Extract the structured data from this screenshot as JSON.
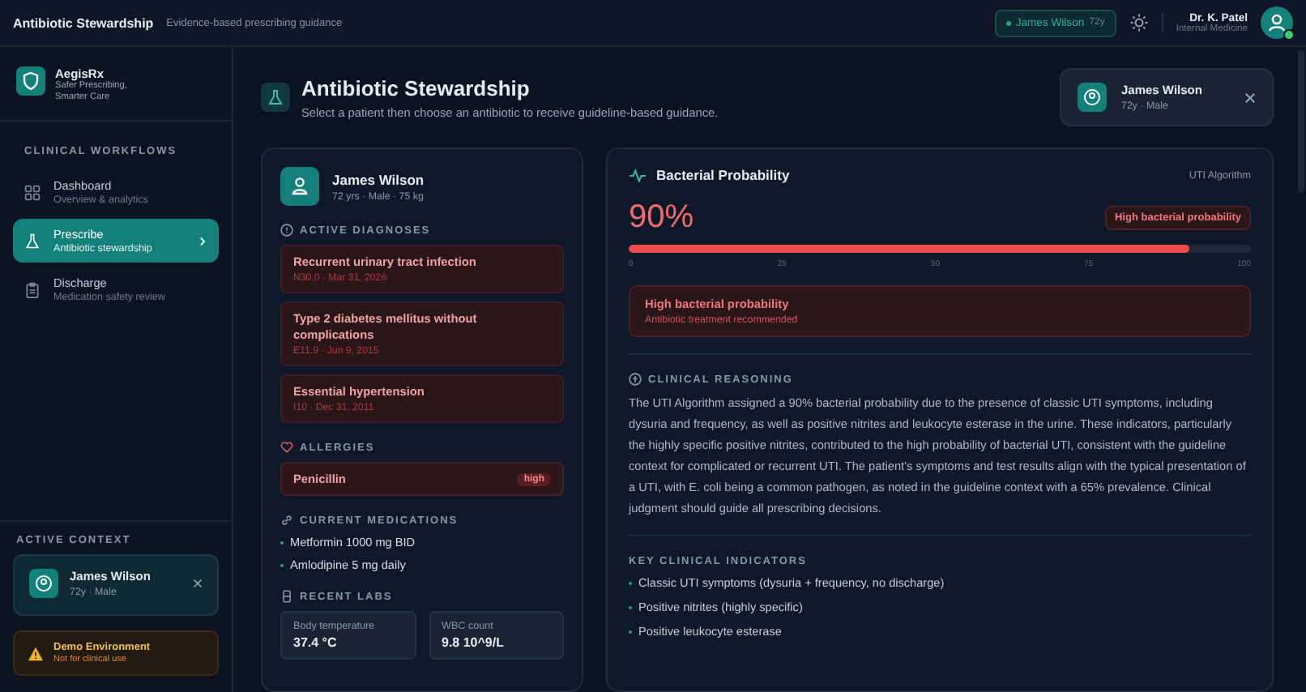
{
  "topbar": {
    "title": "Antibiotic Stewardship",
    "subtitle": "Evidence-based prescribing guidance",
    "patient_chip": {
      "name": "James Wilson",
      "age": "72y"
    },
    "user": {
      "name": "Dr. K. Patel",
      "role": "Internal Medicine",
      "online": true
    }
  },
  "sidebar": {
    "brand": {
      "name": "AegisRx",
      "tagline": "Safer Prescribing, Smarter Care"
    },
    "section_title": "CLINICAL WORKFLOWS",
    "items": [
      {
        "label": "Dashboard",
        "sublabel": "Overview & analytics",
        "selected": false
      },
      {
        "label": "Prescribe",
        "sublabel": "Antibiotic stewardship",
        "selected": true
      },
      {
        "label": "Discharge",
        "sublabel": "Medication safety review",
        "selected": false
      }
    ],
    "context_title": "ACTIVE CONTEXT",
    "context_patient": {
      "name": "James Wilson",
      "details": "72y · Male"
    },
    "warning": {
      "title": "Demo Environment",
      "subtitle": "Not for clinical use"
    }
  },
  "header": {
    "title": "Antibiotic Stewardship",
    "subtitle": "Select a patient then choose an antibiotic to receive guideline-based guidance.",
    "patient": {
      "name": "James Wilson",
      "details": "72y · Male"
    }
  },
  "patient_card": {
    "name": "James Wilson",
    "details": "72 yrs · Male · 75 kg",
    "diagnoses_title": "ACTIVE DIAGNOSES",
    "diagnoses": [
      {
        "name": "Recurrent urinary tract infection",
        "meta": "N30.0 · Mar 31, 2026"
      },
      {
        "name": "Type 2 diabetes mellitus without complications",
        "meta": "E11.9 · Jun 9, 2015"
      },
      {
        "name": "Essential hypertension",
        "meta": "I10 · Dec 31, 2011"
      }
    ],
    "allergies_title": "ALLERGIES",
    "allergies": [
      {
        "name": "Penicillin",
        "severity": "high"
      }
    ],
    "medications_title": "CURRENT MEDICATIONS",
    "medications": [
      "Metformin 1000 mg BID",
      "Amlodipine 5 mg daily"
    ],
    "labs_title": "RECENT LABS",
    "labs": [
      {
        "name": "Body temperature",
        "value": "37.4 °C"
      },
      {
        "name": "WBC count",
        "value": "9.8 10^9/L"
      }
    ]
  },
  "probability_card": {
    "title": "Bacterial Probability",
    "algorithm": "UTI Algorithm",
    "value": "90%",
    "badge": "High bacterial probability",
    "level": 0.9,
    "ticks": [
      "0",
      "25",
      "50",
      "75",
      "100"
    ],
    "alert": {
      "title": "High bacterial probability",
      "subtitle": "Antibiotic treatment recommended"
    },
    "reasoning_title": "CLINICAL REASONING",
    "reasoning": "The UTI Algorithm assigned a 90% bacterial probability due to the presence of classic UTI symptoms, including dysuria and frequency, as well as positive nitrites and leukocyte esterase in the urine. These indicators, particularly the highly specific positive nitrites, contributed to the high probability of bacterial UTI, consistent with the guideline context for complicated or recurrent UTI. The patient's symptoms and test results align with the typical presentation of a UTI, with E. coli being a common pathogen, as noted in the guideline context with a 65% prevalence. Clinical judgment should guide all prescribing decisions.",
    "indicators_title": "KEY CLINICAL INDICATORS",
    "indicators": [
      "Classic UTI symptoms (dysuria + frequency, no discharge)",
      "Positive nitrites (highly specific)",
      "Positive leukocyte esterase"
    ]
  }
}
